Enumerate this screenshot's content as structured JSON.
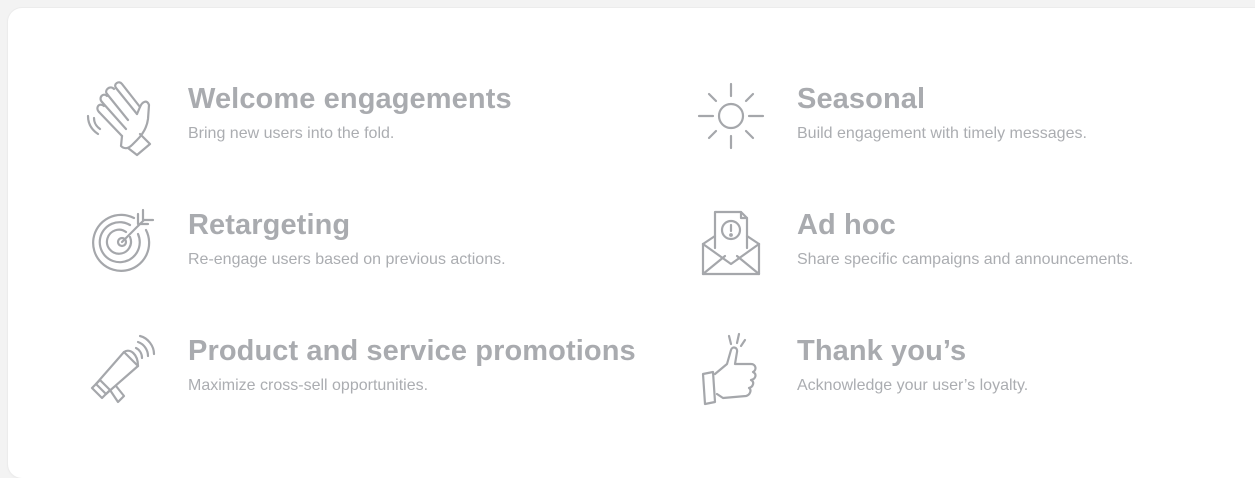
{
  "colors": {
    "icon": "#a5a7ab",
    "title": "#a9abaf",
    "desc": "#abadb1",
    "card": "#ffffff",
    "page": "#f3f3f3"
  },
  "items": [
    {
      "icon": "waving-hand-icon",
      "title": "Welcome engagements",
      "desc": "Bring new users into the fold."
    },
    {
      "icon": "sun-icon",
      "title": "Seasonal",
      "desc": "Build engagement with timely messages."
    },
    {
      "icon": "target-arrow-icon",
      "title": "Retargeting",
      "desc": "Re-engage users based on previous actions."
    },
    {
      "icon": "envelope-alert-icon",
      "title": "Ad hoc",
      "desc": "Share specific campaigns and announcements."
    },
    {
      "icon": "megaphone-icon",
      "title": "Product and service promotions",
      "desc": "Maximize cross-sell opportunities."
    },
    {
      "icon": "thumbs-up-icon",
      "title": "Thank you’s",
      "desc": "Acknowledge your user’s loyalty."
    }
  ]
}
